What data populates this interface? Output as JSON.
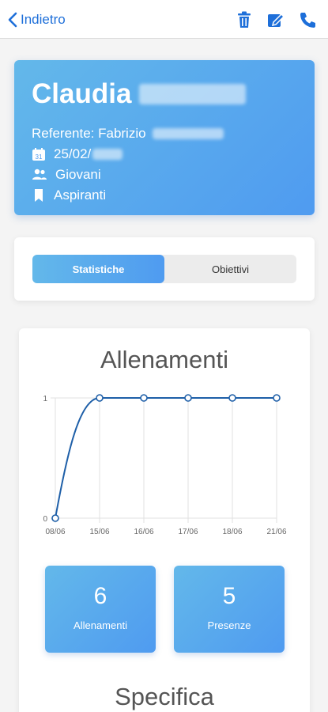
{
  "header": {
    "back_label": "Indietro",
    "icons": [
      "trash-icon",
      "edit-icon",
      "phone-icon"
    ]
  },
  "profile": {
    "first_name": "Claudia",
    "referente": "Referente: Fabrizio",
    "birth_date": "25/02/",
    "group": "Giovani",
    "category": "Aspiranti"
  },
  "tabs": [
    {
      "label": "Statistiche",
      "active": true
    },
    {
      "label": "Obiettivi",
      "active": false
    }
  ],
  "stats": {
    "title": "Allenamenti",
    "tiles": [
      {
        "value": "6",
        "label": "Allenamenti"
      },
      {
        "value": "5",
        "label": "Presenze"
      }
    ],
    "section_title": "Specifica"
  },
  "chart_data": {
    "type": "line",
    "categories": [
      "08/06",
      "15/06",
      "16/06",
      "17/06",
      "18/06",
      "21/06"
    ],
    "series": [
      {
        "values": [
          0,
          1,
          1,
          1,
          1,
          1
        ]
      }
    ],
    "ylim": [
      0,
      1
    ],
    "yticks": [
      "0",
      "1"
    ],
    "grid": true,
    "color": "#1e5fa8"
  },
  "colors": {
    "accent": "#4f9bf0",
    "link": "#1e6fd9"
  }
}
